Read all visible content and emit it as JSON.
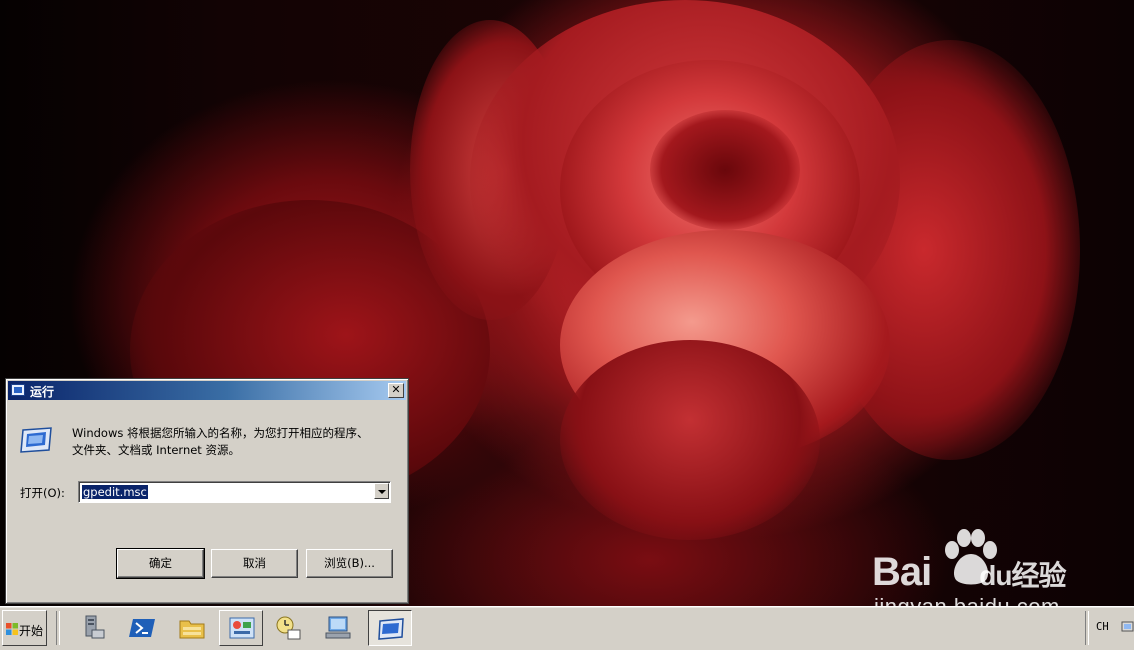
{
  "desktop": {
    "wallpaper": "red-rose",
    "watermark": {
      "brand": "Bai",
      "brand_suffix": "du",
      "cn": "经验",
      "site": "jingyan.baidu.com"
    }
  },
  "run_dialog": {
    "title": "运行",
    "close_glyph": "✕",
    "description_line1": "Windows 将根据您所输入的名称，为您打开相应的程序、",
    "description_line2": "文件夹、文档或 Internet 资源。",
    "open_label": "打开(O):",
    "open_value": "gpedit.msc",
    "buttons": {
      "ok": "确定",
      "cancel": "取消",
      "browse": "浏览(B)..."
    }
  },
  "taskbar": {
    "start_label": "开始",
    "icons": [
      "server-manager-icon",
      "powershell-icon",
      "explorer-folder-icon",
      "control-panel-icon",
      "task-scheduler-icon",
      "network-computer-icon",
      "run-dialog-task-icon"
    ],
    "language": "CH",
    "colors": {
      "titlebar_start": "#0a246a",
      "titlebar_end": "#a6caf0",
      "face": "#d4d0c8"
    }
  }
}
